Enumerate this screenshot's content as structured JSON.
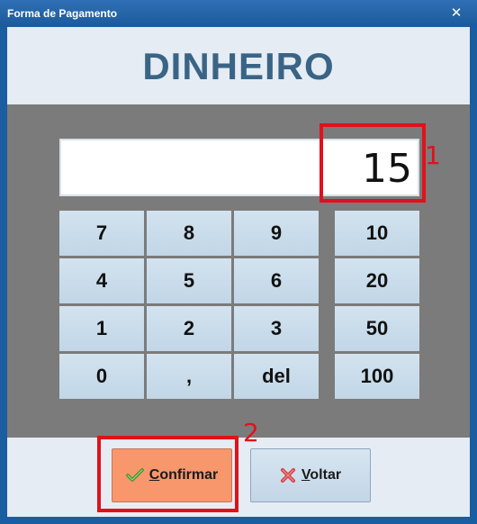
{
  "window": {
    "title": "Forma de Pagamento",
    "close_symbol": "✕"
  },
  "header": {
    "title": "DINHEIRO"
  },
  "display": {
    "value": "15"
  },
  "keypad": {
    "keys": [
      "7",
      "8",
      "9",
      "4",
      "5",
      "6",
      "1",
      "2",
      "3",
      "0",
      ",",
      "del"
    ],
    "quick_amounts": [
      "10",
      "20",
      "50",
      "100"
    ]
  },
  "footer": {
    "confirm": {
      "first_letter": "C",
      "rest": "onfirmar",
      "icon": "check-icon"
    },
    "back": {
      "first_letter": "V",
      "rest": "oltar",
      "icon": "x-icon"
    }
  },
  "annotations": {
    "first": "1",
    "second": "2",
    "color": "#e0111b"
  },
  "colors": {
    "titlebar": "#1b5da1",
    "header_text": "#3a6486",
    "confirm_bg": "#f8966c",
    "panel_bg": "#7b7b7b"
  }
}
